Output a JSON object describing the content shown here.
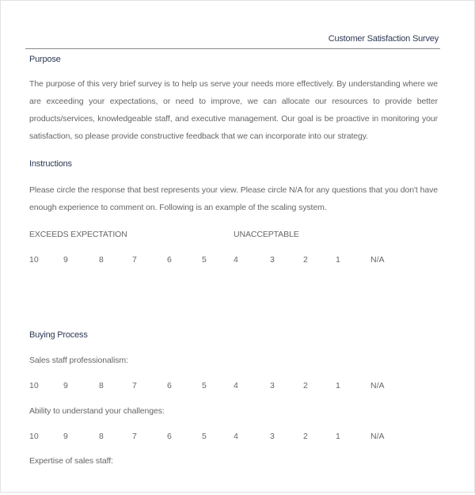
{
  "header": {
    "title": "Customer Satisfaction Survey"
  },
  "purpose": {
    "heading": "Purpose",
    "text": "The purpose of this very brief survey is to help us serve your needs more effectively.  By understanding where we are exceeding your expectations, or need to improve, we can allocate our resources to provide better products/services, knowledgeable staff, and executive management.  Our goal is be proactive in monitoring your satisfaction, so please provide constructive feedback that we can incorporate into our strategy."
  },
  "instructions": {
    "heading": "Instructions",
    "text": "Please circle the response that best represents your view.  Please circle N/A for any questions that you don't have enough experience to comment on.  Following is an example of the scaling system.",
    "scale_high_label": "EXCEEDS EXPECTATION",
    "scale_low_label": "UNACCEPTABLE"
  },
  "scale": [
    "10",
    "9",
    "8",
    "7",
    "6",
    "5",
    "4",
    "3",
    "2",
    "1",
    "N/A"
  ],
  "buying_process": {
    "heading": "Buying Process",
    "questions": [
      {
        "label": "Sales staff professionalism:"
      },
      {
        "label": "Ability to understand your challenges:"
      },
      {
        "label": "Expertise of sales staff:"
      }
    ]
  }
}
